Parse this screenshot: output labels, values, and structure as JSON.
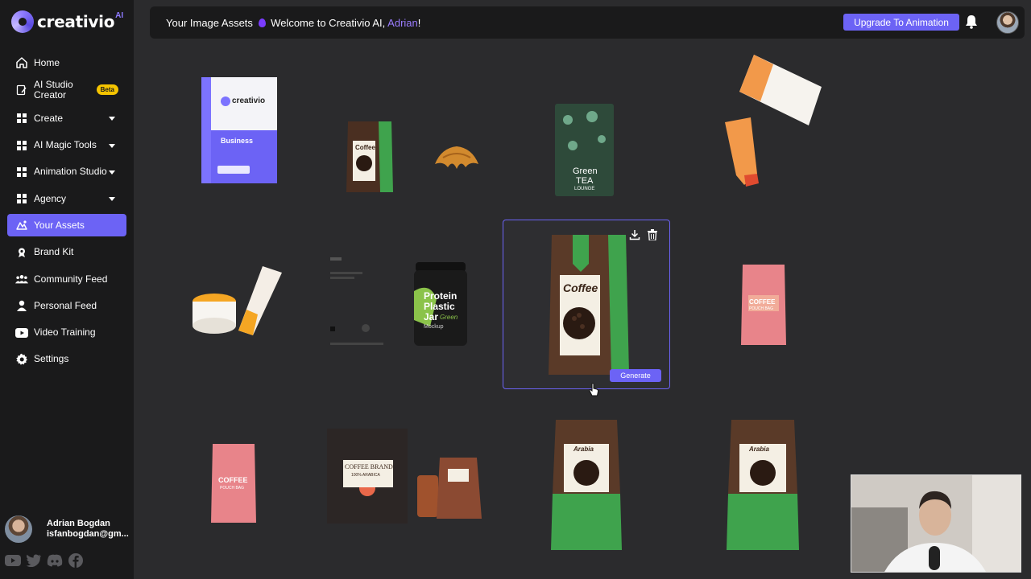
{
  "app": {
    "logo_text": "creativio",
    "logo_sup": "AI"
  },
  "sidebar": {
    "items": [
      {
        "label": "Home"
      },
      {
        "label": "AI Studio Creator",
        "line1": "AI Studio",
        "line2": "Creator",
        "badge": "Beta"
      },
      {
        "label": "Create"
      },
      {
        "label": "AI Magic Tools"
      },
      {
        "label": "Animation Studio"
      },
      {
        "label": "Agency"
      },
      {
        "label": "Your Assets"
      },
      {
        "label": "Brand Kit"
      },
      {
        "label": "Community Feed"
      },
      {
        "label": "Personal Feed"
      },
      {
        "label": "Video Training"
      },
      {
        "label": "Settings"
      }
    ],
    "user": {
      "name": "Adrian Bogdan",
      "email": "isfanbogdan@gm..."
    }
  },
  "header": {
    "prefix": "Your Image Assets",
    "welcome": "Welcome to Creativio AI,",
    "user_name": "Adrian",
    "suffix": "!",
    "upgrade_label": "Upgrade To Animation"
  },
  "assets": {
    "selected_generate_label": "Generate",
    "box_brand": "creativio",
    "box_title": "Business",
    "tea_line1": "Green",
    "tea_line2": "TEA",
    "tea_line3": "LOUNGE",
    "jar_line1": "Protein",
    "jar_line2": "Plastic",
    "jar_line3": "Jar",
    "jar_sub": "Green",
    "jar_mockup": "Mockup",
    "coffee_label": "Coffee",
    "coffee_pink_line1": "COFFEE",
    "coffee_pink_line2": "POUCH BAG",
    "brand_card_line1": "COFFEE BRAND",
    "brand_card_line2": "100% ARABICA",
    "green_bag_label": "Arabia"
  },
  "colors": {
    "accent": "#6c63f5",
    "sidebar_bg": "#1a1a1b",
    "page_bg": "#2b2b2d",
    "beta_badge": "#f5c400",
    "user_name_highlight": "#9b7dff"
  },
  "icons": [
    "home-icon",
    "studio-icon",
    "grid-icon",
    "assets-icon",
    "brand-icon",
    "community-icon",
    "person-icon",
    "youtube-icon",
    "gear-icon",
    "bell-icon",
    "download-icon",
    "trash-icon",
    "twitter-icon",
    "discord-icon",
    "facebook-icon"
  ]
}
